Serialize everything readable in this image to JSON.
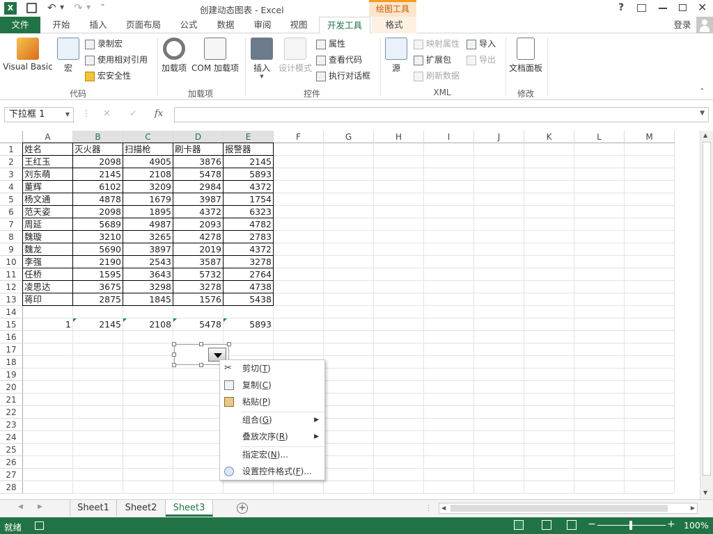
{
  "titlebar": {
    "title": "创建动态图表 - Excel",
    "context_tab": "绘图工具",
    "help": "?",
    "icons": [
      "excel-logo-icon",
      "save-icon",
      "undo-icon",
      "redo-icon",
      "customize-icon",
      "help-icon",
      "ribbon-display-icon",
      "minimize-icon",
      "restore-icon",
      "close-icon"
    ]
  },
  "ribbon_tabs": {
    "file": "文件",
    "home": "开始",
    "insert": "插入",
    "page_layout": "页面布局",
    "formulas": "公式",
    "data": "数据",
    "review": "审阅",
    "view": "视图",
    "developer": "开发工具",
    "format": "格式",
    "login": "登录"
  },
  "ribbon": {
    "code": {
      "visual_basic": "Visual Basic",
      "macros": "宏",
      "record_macro": "录制宏",
      "relative_ref": "使用相对引用",
      "macro_security": "宏安全性",
      "group": "代码"
    },
    "addins": {
      "addins": "加载项",
      "com_addins": "COM 加载项",
      "group": "加载项"
    },
    "controls": {
      "insert": "插入",
      "design_mode": "设计模式",
      "properties": "属性",
      "view_code": "查看代码",
      "run_dialog": "执行对话框",
      "group": "控件"
    },
    "xml": {
      "source": "源",
      "map_props": "映射属性",
      "expansion": "扩展包",
      "refresh": "刷新数据",
      "import": "导入",
      "export": "导出",
      "group": "XML"
    },
    "modify": {
      "doc_panel": "文档面板",
      "group": "修改"
    }
  },
  "formula_bar": {
    "name_box": "下拉框 1",
    "cancel": "✕",
    "enter": "✓",
    "fx": "fx",
    "formula": ""
  },
  "columns": [
    "A",
    "B",
    "C",
    "D",
    "E",
    "F",
    "G",
    "H",
    "I",
    "J",
    "K",
    "L",
    "M"
  ],
  "rows": [
    "1",
    "2",
    "3",
    "4",
    "5",
    "6",
    "7",
    "8",
    "9",
    "10",
    "11",
    "12",
    "13",
    "14",
    "15",
    "16",
    "17",
    "18",
    "19",
    "20",
    "21",
    "22",
    "23",
    "24",
    "25",
    "26",
    "27",
    "28"
  ],
  "table": {
    "headers": [
      "姓名",
      "灭火器",
      "扫描枪",
      "刷卡器",
      "报警器"
    ],
    "data": [
      [
        "王红玉",
        "2098",
        "4905",
        "3876",
        "2145"
      ],
      [
        "刘东萌",
        "2145",
        "2108",
        "5478",
        "5893"
      ],
      [
        "董辉",
        "6102",
        "3209",
        "2984",
        "4372"
      ],
      [
        "杨文通",
        "4878",
        "1679",
        "3987",
        "1754"
      ],
      [
        "范天姿",
        "2098",
        "1895",
        "4372",
        "6323"
      ],
      [
        "周延",
        "5689",
        "4987",
        "2093",
        "4782"
      ],
      [
        "魏璇",
        "3210",
        "3265",
        "4278",
        "2783"
      ],
      [
        "魏龙",
        "5690",
        "3897",
        "2019",
        "4372"
      ],
      [
        "李强",
        "2190",
        "2543",
        "3587",
        "3278"
      ],
      [
        "任桥",
        "1595",
        "3643",
        "5732",
        "2764"
      ],
      [
        "凌思达",
        "3675",
        "3298",
        "3278",
        "4738"
      ],
      [
        "蒋印",
        "2875",
        "1845",
        "1576",
        "5438"
      ]
    ]
  },
  "row15": [
    "1",
    "2145",
    "2108",
    "5478",
    "5893"
  ],
  "context_menu": {
    "cut": {
      "text": "剪切(",
      "key": "T",
      "end": ")"
    },
    "copy": {
      "text": "复制(",
      "key": "C",
      "end": ")"
    },
    "paste": {
      "text": "粘贴(",
      "key": "P",
      "end": ")"
    },
    "group": {
      "text": "组合(",
      "key": "G",
      "end": ")"
    },
    "order": {
      "text": "叠放次序(",
      "key": "R",
      "end": ")"
    },
    "assign_macro": {
      "text": "指定宏(",
      "key": "N",
      "end": ")..."
    },
    "format_control": {
      "text": "设置控件格式(",
      "key": "F",
      "end": ")..."
    }
  },
  "sheet_tabs": [
    "Sheet1",
    "Sheet2",
    "Sheet3"
  ],
  "status": {
    "ready": "就绪",
    "zoom": "100%",
    "minus": "−",
    "plus": "+"
  }
}
